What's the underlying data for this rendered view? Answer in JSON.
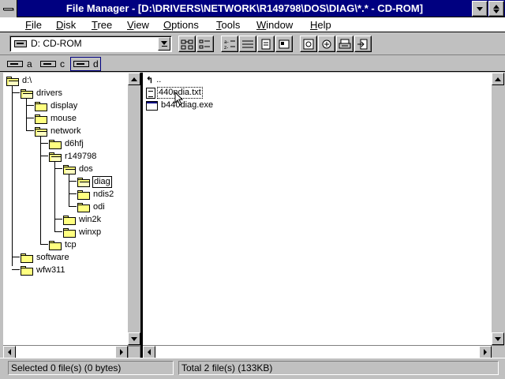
{
  "window": {
    "title": "File Manager - [D:\\DRIVERS\\NETWORK\\R149798\\DOS\\DIAG\\*.* - CD-ROM]"
  },
  "menu": [
    "File",
    "Disk",
    "Tree",
    "View",
    "Options",
    "Tools",
    "Window",
    "Help"
  ],
  "toolbar": {
    "drive_select": "D: CD-ROM",
    "buttons": [
      "connect-network-drive-icon",
      "disconnect-network-drive-icon",
      "name-view-icon",
      "details-view-icon",
      "sort-by-name-icon",
      "sort-by-type-icon",
      "sort-by-size-icon",
      "sort-by-date-icon",
      "share-icon",
      "stop-sharing-icon",
      "printer-icon",
      "exit-icon"
    ]
  },
  "drives": [
    {
      "letter": "a",
      "type": "floppy"
    },
    {
      "letter": "c",
      "type": "hard-disk"
    },
    {
      "letter": "d",
      "type": "cd-rom",
      "selected": true
    }
  ],
  "tree": [
    {
      "label": "d:\\"
    },
    {
      "label": "drivers"
    },
    {
      "label": "display"
    },
    {
      "label": "mouse"
    },
    {
      "label": "network"
    },
    {
      "label": "d6hfj"
    },
    {
      "label": "r149798"
    },
    {
      "label": "dos"
    },
    {
      "label": "diag",
      "selected": true
    },
    {
      "label": "ndis2"
    },
    {
      "label": "odi"
    },
    {
      "label": "win2k"
    },
    {
      "label": "winxp"
    },
    {
      "label": "tcp"
    },
    {
      "label": "software"
    },
    {
      "label": "wfw311"
    }
  ],
  "files": {
    "up_label": "..",
    "items": [
      {
        "name": "440ndia.txt",
        "type": "document"
      },
      {
        "name": "b440diag.exe",
        "type": "program"
      }
    ]
  },
  "status": {
    "selected": "Selected 0 file(s) (0 bytes)",
    "total": "Total 2 file(s) (133KB)"
  }
}
